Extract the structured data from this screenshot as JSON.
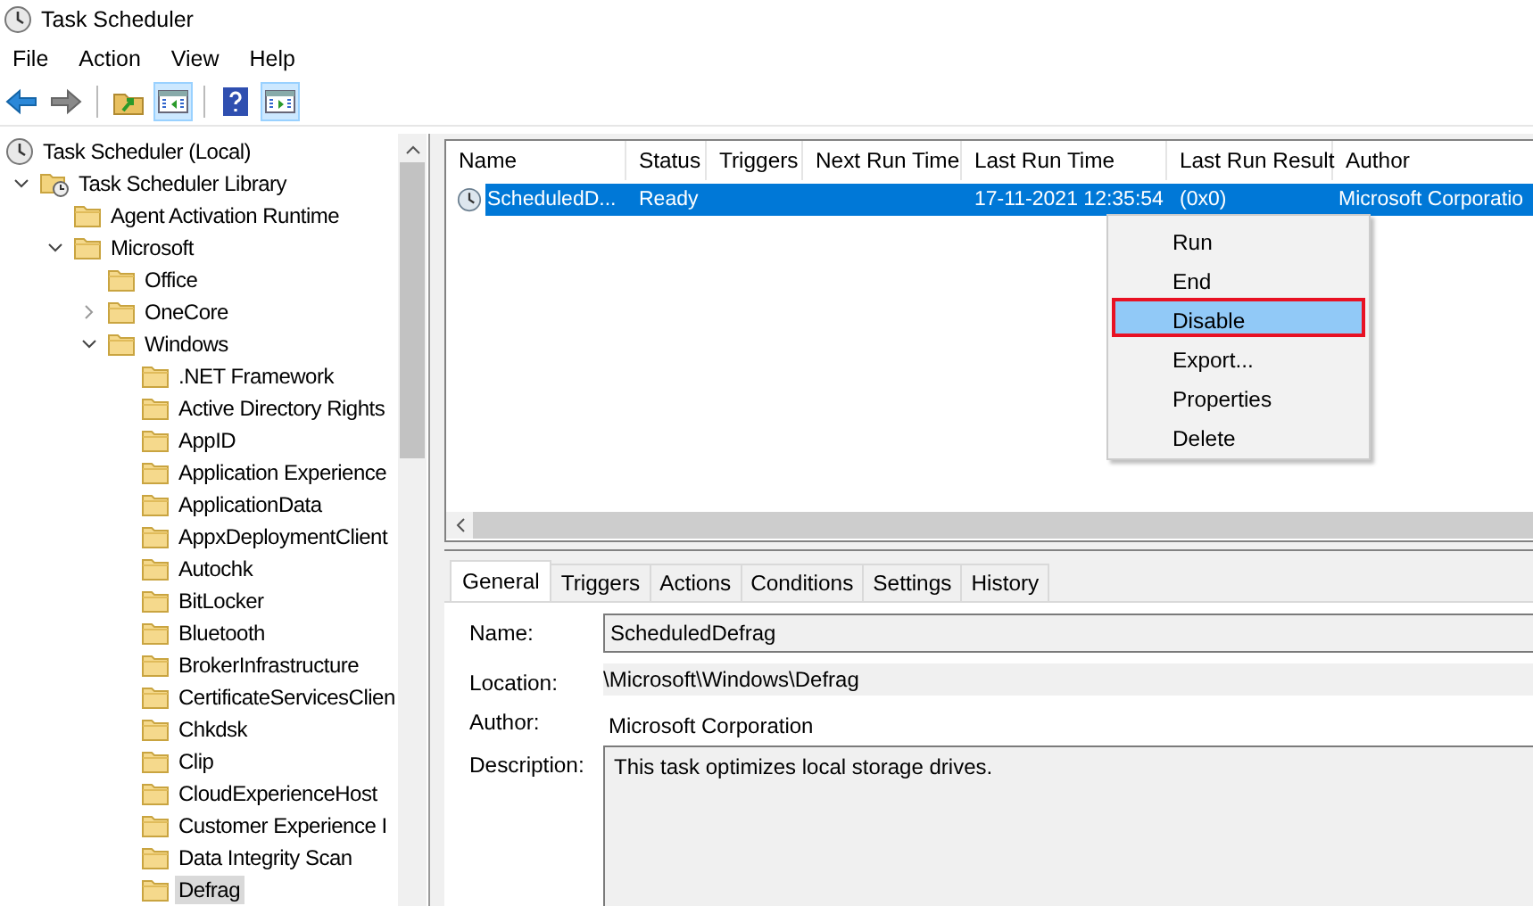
{
  "window": {
    "title": "Task Scheduler"
  },
  "menu": [
    "File",
    "Action",
    "View",
    "Help"
  ],
  "toolbar": [
    {
      "kind": "back",
      "on": false
    },
    {
      "kind": "forward",
      "on": false
    },
    {
      "kind": "separator"
    },
    {
      "kind": "folder-up",
      "on": false
    },
    {
      "kind": "panel-left",
      "on": true
    },
    {
      "kind": "separator"
    },
    {
      "kind": "help",
      "on": false
    },
    {
      "kind": "panel-right",
      "on": true
    }
  ],
  "tree": [
    {
      "label": "Task Scheduler (Local)",
      "kind": "root",
      "selected": false,
      "children": [
        {
          "label": "Task Scheduler Library",
          "kind": "library",
          "expanded": true,
          "selected": false,
          "children": [
            {
              "label": "Agent Activation Runtime",
              "kind": "folder",
              "selected": false
            },
            {
              "label": "Microsoft",
              "kind": "folder",
              "expanded": true,
              "selected": false,
              "children": [
                {
                  "label": "Office",
                  "kind": "folder",
                  "selected": false
                },
                {
                  "label": "OneCore",
                  "kind": "folder",
                  "expanded": false,
                  "selected": false
                },
                {
                  "label": "Windows",
                  "kind": "folder",
                  "expanded": true,
                  "selected": false,
                  "children": [
                    {
                      "label": ".NET Framework",
                      "kind": "folder",
                      "selected": false
                    },
                    {
                      "label": "Active Directory Rights",
                      "kind": "folder",
                      "selected": false
                    },
                    {
                      "label": "AppID",
                      "kind": "folder",
                      "selected": false
                    },
                    {
                      "label": "Application Experience",
                      "kind": "folder",
                      "selected": false
                    },
                    {
                      "label": "ApplicationData",
                      "kind": "folder",
                      "selected": false
                    },
                    {
                      "label": "AppxDeploymentClient",
                      "kind": "folder",
                      "selected": false
                    },
                    {
                      "label": "Autochk",
                      "kind": "folder",
                      "selected": false
                    },
                    {
                      "label": "BitLocker",
                      "kind": "folder",
                      "selected": false
                    },
                    {
                      "label": "Bluetooth",
                      "kind": "folder",
                      "selected": false
                    },
                    {
                      "label": "BrokerInfrastructure",
                      "kind": "folder",
                      "selected": false
                    },
                    {
                      "label": "CertificateServicesClien",
                      "kind": "folder",
                      "selected": false
                    },
                    {
                      "label": "Chkdsk",
                      "kind": "folder",
                      "selected": false
                    },
                    {
                      "label": "Clip",
                      "kind": "folder",
                      "selected": false
                    },
                    {
                      "label": "CloudExperienceHost",
                      "kind": "folder",
                      "selected": false
                    },
                    {
                      "label": "Customer Experience I",
                      "kind": "folder",
                      "selected": false
                    },
                    {
                      "label": "Data Integrity Scan",
                      "kind": "folder",
                      "selected": false
                    },
                    {
                      "label": "Defrag",
                      "kind": "folder",
                      "selected": true
                    }
                  ]
                }
              ]
            }
          ]
        }
      ]
    }
  ],
  "table": {
    "columns": [
      "Name",
      "Status",
      "Triggers",
      "Next Run Time",
      "Last Run Time",
      "Last Run Result",
      "Author"
    ],
    "rows": [
      {
        "selected": true,
        "cells": [
          "ScheduledD...",
          "Ready",
          "",
          "",
          "17-11-2021 12:35:54",
          "(0x0)",
          "Microsoft Corporatio"
        ]
      }
    ]
  },
  "context_menu": [
    {
      "label": "Run",
      "selected": false
    },
    {
      "label": "End",
      "selected": false
    },
    {
      "label": "Disable",
      "selected": true
    },
    {
      "label": "Export...",
      "selected": false
    },
    {
      "label": "Properties",
      "selected": false
    },
    {
      "label": "Delete",
      "selected": false
    }
  ],
  "tabs": [
    {
      "label": "General",
      "selected": true
    },
    {
      "label": "Triggers",
      "selected": false
    },
    {
      "label": "Actions",
      "selected": false
    },
    {
      "label": "Conditions",
      "selected": false
    },
    {
      "label": "Settings",
      "selected": false
    },
    {
      "label": "History",
      "selected": false
    }
  ],
  "details": [
    {
      "label": "Name:",
      "kind": "field",
      "value": "ScheduledDefrag"
    },
    {
      "label": "Location:",
      "kind": "readonly",
      "value": "\\Microsoft\\Windows\\Defrag"
    },
    {
      "label": "Author:",
      "kind": "text",
      "value": "Microsoft Corporation"
    },
    {
      "label": "Description:",
      "kind": "textarea",
      "value": "This task optimizes local storage drives."
    }
  ]
}
